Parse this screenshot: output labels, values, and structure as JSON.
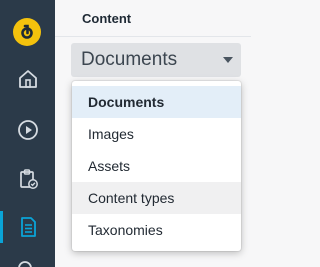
{
  "pane": {
    "title": "Content"
  },
  "select": {
    "value": "Documents"
  },
  "menu": {
    "items": [
      {
        "label": "Documents",
        "state": "selected"
      },
      {
        "label": "Images",
        "state": ""
      },
      {
        "label": "Assets",
        "state": ""
      },
      {
        "label": "Content types",
        "state": "hover"
      },
      {
        "label": "Taxonomies",
        "state": ""
      }
    ]
  },
  "rail": {
    "items": [
      {
        "icon": "home-icon"
      },
      {
        "icon": "play-icon"
      },
      {
        "icon": "clipboard-check-icon"
      },
      {
        "icon": "document-icon",
        "active": true
      },
      {
        "icon": "search-icon"
      }
    ]
  },
  "colors": {
    "rail_bg": "#2b3a49",
    "logo": "#f4c20d",
    "active_accent": "#0aa4d8",
    "selected_item_bg": "#e3eef8",
    "hover_item_bg": "#f0f0f1"
  }
}
